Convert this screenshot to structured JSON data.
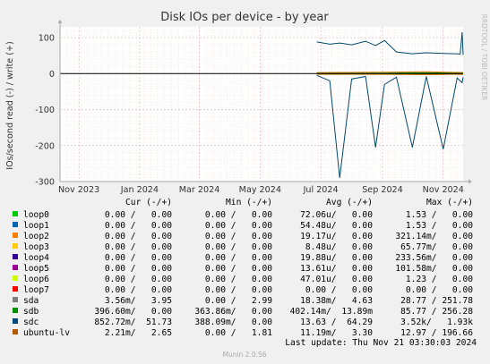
{
  "chart_data": {
    "type": "line",
    "title": "Disk IOs per device - by year",
    "ylabel": "IOs/second read (-) / write (+)",
    "side_label": "RRDTOOL / TOBI OETIKER",
    "x_ticks": [
      "Nov 2023",
      "Jan 2024",
      "Mar 2024",
      "May 2024",
      "Jul 2024",
      "Sep 2024",
      "Nov 2024"
    ],
    "y_ticks": [
      "100",
      "0",
      "-100",
      "-200",
      "-300"
    ],
    "ylim": [
      -300,
      130
    ],
    "xlim": [
      "2023-10-13",
      "2024-11-21"
    ],
    "grid": true,
    "series": [
      {
        "name": "sdc",
        "color": "#00486A",
        "x": [
          "2024-06-27",
          "2024-07-10",
          "2024-07-20",
          "2024-08-01",
          "2024-08-15",
          "2024-08-25",
          "2024-09-03",
          "2024-09-15",
          "2024-10-01",
          "2024-10-15",
          "2024-11-01",
          "2024-11-15",
          "2024-11-18",
          "2024-11-20",
          "2024-11-21"
        ],
        "write": [
          88,
          82,
          85,
          80,
          90,
          78,
          92,
          60,
          55,
          58,
          56,
          55,
          54,
          115,
          52
        ],
        "read": [
          -5,
          -20,
          -290,
          -15,
          -8,
          -205,
          -30,
          -10,
          -205,
          -8,
          -210,
          -12,
          -20,
          -25,
          -10
        ]
      },
      {
        "name": "sdb",
        "color": "#008F00",
        "x": [
          "2024-06-27",
          "2024-09-01",
          "2024-11-21"
        ],
        "write": [
          2,
          3,
          2
        ],
        "read": [
          -1,
          -1,
          -1
        ]
      },
      {
        "name": "ubuntu-lv",
        "color": "#CC7A00",
        "x": [
          "2024-06-27",
          "2024-09-01",
          "2024-10-15",
          "2024-11-21"
        ],
        "write": [
          3,
          4,
          5,
          3
        ],
        "read": [
          -2,
          -2,
          -3,
          -2
        ]
      }
    ],
    "legend_header": [
      "Cur (-/+)",
      "Min (-/+)",
      "Avg (-/+)",
      "Max (-/+)"
    ],
    "legend": [
      {
        "name": "loop0",
        "color": "#00CC00",
        "cur": "0.00 /   0.00",
        "min": "0.00 /   0.00",
        "avg": "72.06u/   0.00",
        "max": "1.53 /   0.00"
      },
      {
        "name": "loop1",
        "color": "#0066B3",
        "cur": "0.00 /   0.00",
        "min": "0.00 /   0.00",
        "avg": "54.48u/   0.00",
        "max": "1.53 /   0.00"
      },
      {
        "name": "loop2",
        "color": "#FF8000",
        "cur": "0.00 /   0.00",
        "min": "0.00 /   0.00",
        "avg": "19.17u/   0.00",
        "max": "321.14m/   0.00"
      },
      {
        "name": "loop3",
        "color": "#FFCC00",
        "cur": "0.00 /   0.00",
        "min": "0.00 /   0.00",
        "avg": "8.48u/   0.00",
        "max": "65.77m/   0.00"
      },
      {
        "name": "loop4",
        "color": "#330099",
        "cur": "0.00 /   0.00",
        "min": "0.00 /   0.00",
        "avg": "19.88u/   0.00",
        "max": "233.56m/   0.00"
      },
      {
        "name": "loop5",
        "color": "#990099",
        "cur": "0.00 /   0.00",
        "min": "0.00 /   0.00",
        "avg": "13.61u/   0.00",
        "max": "101.58m/   0.00"
      },
      {
        "name": "loop6",
        "color": "#CCFF00",
        "cur": "0.00 /   0.00",
        "min": "0.00 /   0.00",
        "avg": "47.01u/   0.00",
        "max": "1.23 /   0.00"
      },
      {
        "name": "loop7",
        "color": "#FF0000",
        "cur": "0.00 /   0.00",
        "min": "0.00 /   0.00",
        "avg": "0.00 /   0.00",
        "max": "0.00 /   0.00"
      },
      {
        "name": "sda",
        "color": "#808080",
        "cur": "3.56m/   3.95",
        "min": "0.00 /   2.99",
        "avg": "18.38m/   4.63",
        "max": "28.77 / 251.78"
      },
      {
        "name": "sdb",
        "color": "#008F00",
        "cur": "396.60m/   0.00",
        "min": "363.86m/   0.00",
        "avg": "402.14m/  13.89m",
        "max": "85.77 / 256.28"
      },
      {
        "name": "sdc",
        "color": "#00487D",
        "cur": "852.72m/  51.73",
        "min": "388.09m/   0.00",
        "avg": "13.63 /  64.29",
        "max": "3.52k/   1.93k"
      },
      {
        "name": "ubuntu-lv",
        "color": "#B35A00",
        "cur": "2.21m/   2.65",
        "min": "0.00 /   1.81",
        "avg": "11.19m/   3.30",
        "max": "12.97 / 196.66"
      }
    ],
    "last_update": "Last update: Thu Nov 21 03:30:03 2024",
    "footer": "Munin 2.0.56"
  }
}
